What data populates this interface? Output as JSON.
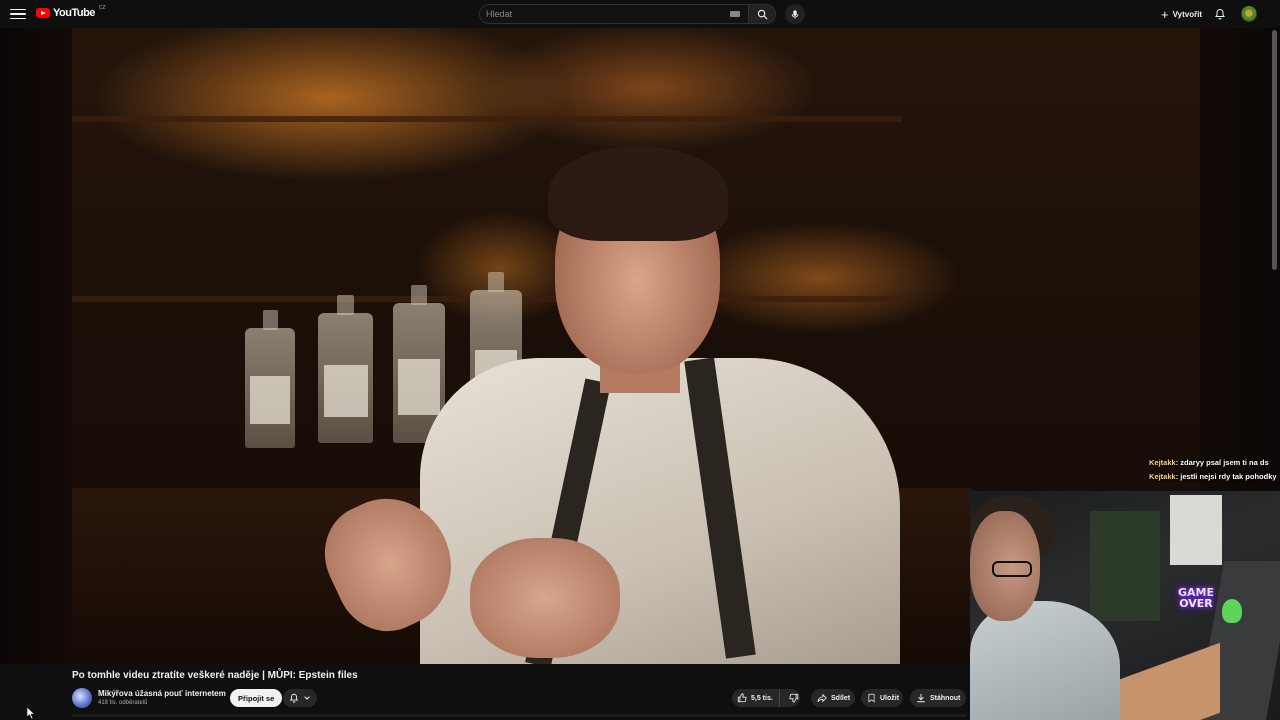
{
  "header": {
    "logo_text": "YouTube",
    "country_code": "CZ",
    "search_placeholder": "Hledat",
    "create_label": "Vytvořit"
  },
  "chat": [
    {
      "user": "Kejtakk",
      "message": ": zdaryy psal jsem ti na ds"
    },
    {
      "user": "Kejtakk",
      "message": ": jestli nejsi rdy tak pohodky"
    }
  ],
  "webcam": {
    "sign_text_1": "GAME",
    "sign_text_2": "OVER"
  },
  "video": {
    "title": "Po tomhle videu ztratíte veškeré naděje | MŮPI: Epstein files",
    "channel_name": "Mikýřova úžasná pouť internetem",
    "subscribers": "418 tis. odběratelů",
    "join_label": "Připojit se",
    "likes": "5,5 tis.",
    "share_label": "Sdílet",
    "save_label": "Uložit",
    "download_label": "Stáhnout"
  },
  "colors": {
    "background": "#0f0f0f",
    "brand_red": "#ff0000",
    "chat_user": "#ffd57a"
  }
}
